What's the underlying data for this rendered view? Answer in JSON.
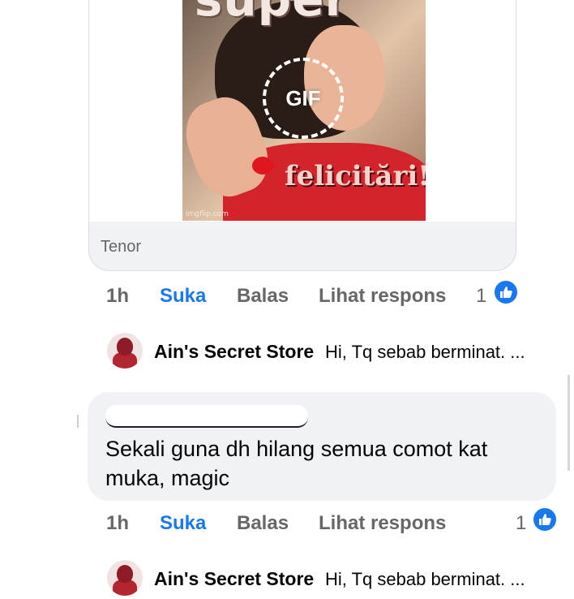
{
  "gif": {
    "top_text": "super",
    "bottom_text": "felicitări!",
    "watermark": "imgflip.com",
    "badge": "GIF",
    "source": "Tenor"
  },
  "comment1_actions": {
    "time": "1h",
    "like": "Suka",
    "reply": "Balas",
    "view": "Lihat respons",
    "reaction_count": "1",
    "reaction_icon": "like-thumb-icon"
  },
  "reply_preview1": {
    "name": "Ain's Secret Store",
    "text": "Hi, Tq sebab berminat. ..."
  },
  "comment2": {
    "text": "Sekali guna dh hilang semua comot kat muka, magic"
  },
  "comment2_actions": {
    "time": "1h",
    "like": "Suka",
    "reply": "Balas",
    "view": "Lihat respons",
    "reaction_count": "1",
    "reaction_icon": "like-thumb-icon"
  },
  "reply_preview2": {
    "name": "Ain's Secret Store",
    "text": "Hi, Tq sebab berminat. ..."
  },
  "colors": {
    "accent": "#1877f2",
    "secondary_text": "#65676b",
    "bubble_bg": "#f0f2f5"
  }
}
